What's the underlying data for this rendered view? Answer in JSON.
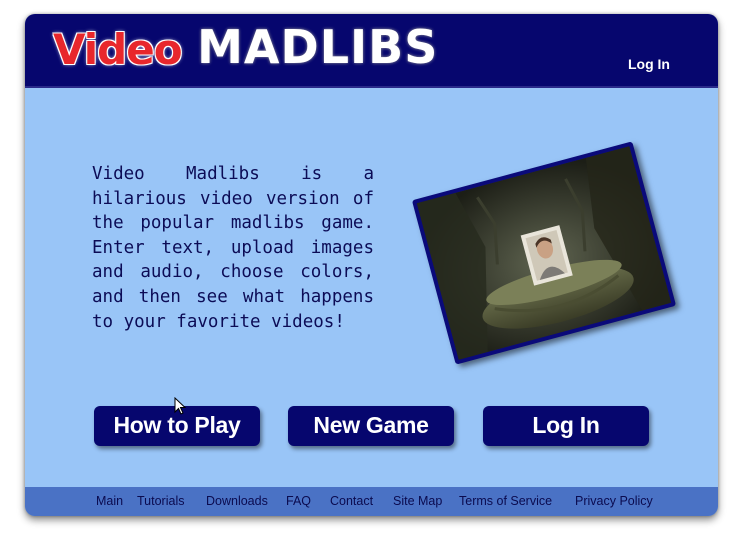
{
  "header": {
    "logo_video": "Video",
    "logo_madlibs": "MADLIBS",
    "login_link": "Log In"
  },
  "main": {
    "intro": "Video Madlibs is a hilarious video version of the popular madlibs game. Enter text, upload images and audio, choose colors, and then see what happens to your favorite videos!",
    "buttons": {
      "how_to_play": "How to Play",
      "new_game": "New Game",
      "log_in": "Log In"
    }
  },
  "footer": {
    "links": [
      "Main",
      "Tutorials",
      "Downloads",
      "FAQ",
      "Contact",
      "Site Map",
      "Terms of Service",
      "Privacy Policy"
    ]
  },
  "colors": {
    "background": "#99c5f7",
    "header": "#06066e",
    "button": "#06066e",
    "footer": "#4a72c5",
    "logo_red": "#e8272c"
  }
}
